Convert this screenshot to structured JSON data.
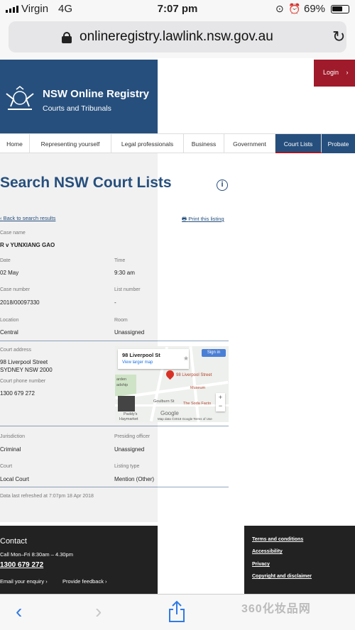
{
  "status_bar": {
    "carrier": "Virgin",
    "network": "4G",
    "time": "7:07 pm",
    "battery": "69%",
    "battery_level": 0.69
  },
  "browser": {
    "url": "onlineregistry.lawlink.nsw.gov.au"
  },
  "site": {
    "title": "NSW Online Registry",
    "subtitle": "Courts and Tribunals",
    "login_label": "Login",
    "login_chevron": "›"
  },
  "nav": {
    "items": [
      {
        "label": "Home"
      },
      {
        "label": "Representing yourself"
      },
      {
        "label": "Legal professionals"
      },
      {
        "label": "Business"
      },
      {
        "label": "Government"
      },
      {
        "label": "Court Lists"
      },
      {
        "label": "Probate"
      }
    ]
  },
  "page": {
    "heading": "Search NSW Court Lists",
    "info_symbol": "i",
    "back_link": "Back to search results",
    "print_link": "Print this listing"
  },
  "listing": {
    "case_name_label": "Case name",
    "case_name": "R v YUNXIANG GAO",
    "date_label": "Date",
    "date": "02 May",
    "time_label": "Time",
    "time": "9:30 am",
    "case_number_label": "Case number",
    "case_number": "2018/00097330",
    "list_number_label": "List number",
    "list_number": "-",
    "location_label": "Location",
    "location": "Central",
    "room_label": "Room",
    "room": "Unassigned",
    "court_address_label": "Court address",
    "court_address_line1": "98 Liverpool Street",
    "court_address_line2": "SYDNEY NSW 2000",
    "court_phone_label": "Court phone number",
    "court_phone": "1300 679 272",
    "jurisdiction_label": "Jurisdiction",
    "jurisdiction": "Criminal",
    "presiding_officer_label": "Presiding officer",
    "presiding_officer": "Unassigned",
    "court_label": "Court",
    "court": "Local Court",
    "listing_type_label": "Listing type",
    "listing_type": "Mention (Other)",
    "refreshed": "Data last refreshed at 7:07pm 18 Apr 2018"
  },
  "map": {
    "card_title": "98 Liverpool St",
    "card_link": "View larger map",
    "sign_in": "Sign in",
    "pin_label": "98 Liverpool Street",
    "place1": "arden",
    "place2": "adship",
    "place3": "Museum",
    "place4": "The Soda Facto",
    "place5": "Goulburn St",
    "place6": "Haymarket",
    "place7": "Paddy's",
    "google": "Google",
    "footer": "Map data ©2018 Google    Terms of Use",
    "zoom_in": "+",
    "zoom_out": "−"
  },
  "footer": {
    "contact_title": "Contact",
    "hours": "Call Mon–Fri 8:30am – 4.30pm",
    "phone": "1300 679 272",
    "email_link": "Email your enquiry  ›",
    "feedback_link": "Provide feedback  ›",
    "links": [
      "Terms and conditions",
      "Accessibility",
      "Privacy",
      "Copyright and disclaimer"
    ]
  },
  "watermark": "360化妆品网"
}
